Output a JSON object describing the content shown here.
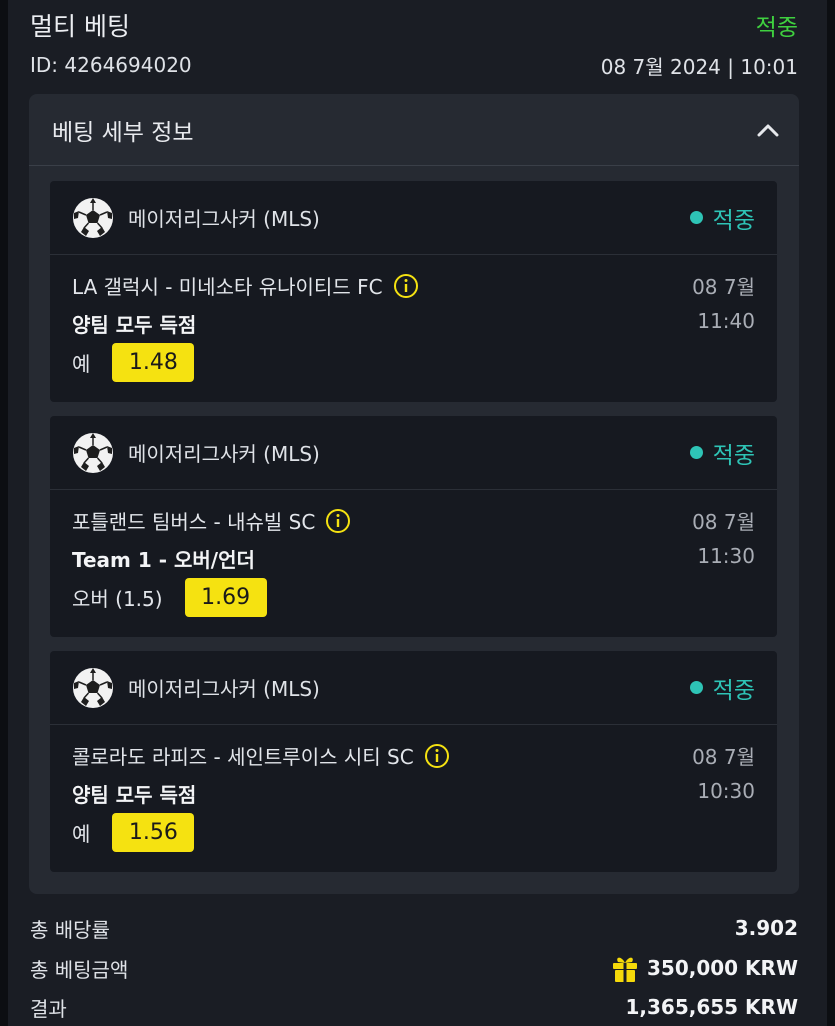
{
  "header": {
    "title": "멀티 베팅",
    "status": "적중",
    "id_label": "ID: 4264694020",
    "datetime": "08 7월 2024 | 10:01"
  },
  "details": {
    "title": "베팅 세부 정보",
    "bets": [
      {
        "league": "메이저리그사커 (MLS)",
        "status": "적중",
        "match": "LA 갤럭시 - 미네소타 유나이티드 FC",
        "market": "양팀 모두 득점",
        "selection": "예",
        "odds": "1.48",
        "date": "08 7월",
        "time": "11:40"
      },
      {
        "league": "메이저리그사커 (MLS)",
        "status": "적중",
        "match": "포틀랜드 팀버스 - 내슈빌 SC",
        "market": "Team 1 - 오버/언더",
        "selection": "오버 (1.5)",
        "odds": "1.69",
        "date": "08 7월",
        "time": "11:30"
      },
      {
        "league": "메이저리그사커 (MLS)",
        "status": "적중",
        "match": "콜로라도 라피즈 - 세인트루이스 시티 SC",
        "market": "양팀 모두 득점",
        "selection": "예",
        "odds": "1.56",
        "date": "08 7월",
        "time": "10:30"
      }
    ]
  },
  "summary": {
    "total_odds_label": "총 배당률",
    "total_odds": "3.902",
    "total_stake_label": "총 베팅금액",
    "total_stake": "350,000 KRW",
    "result_label": "결과",
    "result": "1,365,655 KRW"
  },
  "colors": {
    "win_green": "#3fd03f",
    "teal": "#2ec4b6",
    "odds_yellow": "#f5e211",
    "gift_yellow": "#f5d90a"
  },
  "icons": {
    "league": "soccer-ball-icon",
    "info": "info-icon",
    "collapse": "chevron-up-icon",
    "stake": "gift-icon"
  }
}
